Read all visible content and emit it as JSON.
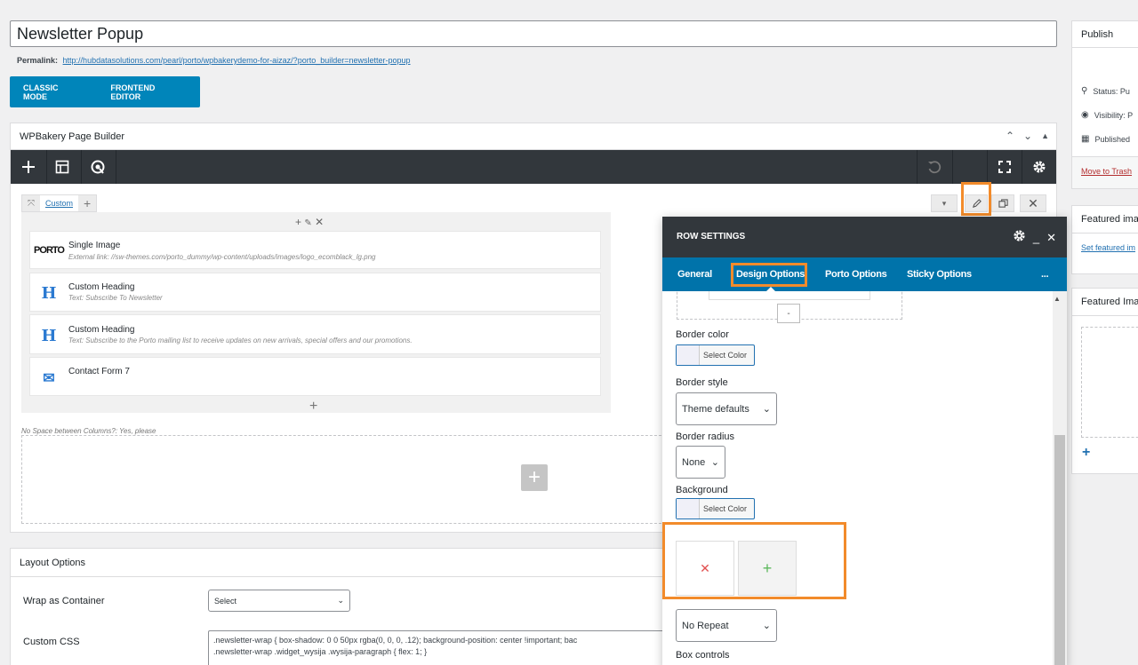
{
  "post": {
    "title": "Newsletter Popup",
    "permalink_label": "Permalink:",
    "permalink_url": "http://hubdatasolutions.com/pearl/porto/wpbakerydemo-for-aizaz/?porto_builder=newsletter-popup"
  },
  "modes": {
    "classic": "CLASSIC MODE",
    "frontend": "FRONTEND EDITOR"
  },
  "builder": {
    "title": "WPBakery Page Builder",
    "row_tab": "Custom",
    "elements": [
      {
        "name": "Single Image",
        "desc": "External link: //sw-themes.com/porto_dummy/wp-content/uploads/images/logo_ecomblack_lg.png",
        "icon": "porto-logo-icon",
        "icon_text": "PORTO"
      },
      {
        "name": "Custom Heading",
        "desc": "Text: Subscribe To Newsletter",
        "icon": "heading-icon",
        "icon_text": "H"
      },
      {
        "name": "Custom Heading",
        "desc": "Text: Subscribe to the Porto mailing list to receive updates on new arrivals, special offers and our promotions.",
        "icon": "heading-icon",
        "icon_text": "H"
      },
      {
        "name": "Contact Form 7",
        "desc": "",
        "icon": "envelope-icon",
        "icon_text": "✉"
      }
    ],
    "no_space": "No Space between Columns?: Yes, please"
  },
  "layout_options": {
    "title": "Layout Options",
    "wrap_label": "Wrap as Container",
    "wrap_value": "Select",
    "css_label": "Custom CSS",
    "css_line1": ".newsletter-wrap { box-shadow: 0 0 50px rgba(0, 0, 0, .12); background-position: center !important; bac",
    "css_line2": ".newsletter-wrap .widget_wysija .wysija-paragraph { flex: 1; }"
  },
  "sidebar": {
    "publish": "Publish",
    "status": "Status: Pu",
    "visibility": "Visibility: P",
    "published": "Published",
    "trash": "Move to Trash",
    "featured1": "Featured ima",
    "featured1_link": "Set featured im",
    "featured2": "Featured Ima"
  },
  "modal": {
    "title": "ROW SETTINGS",
    "tabs": [
      "General",
      "Design Options",
      "Porto Options",
      "Sticky Options"
    ],
    "more": "...",
    "minus": "-",
    "border_color": "Border color",
    "select_color": "Select Color",
    "border_style": "Border style",
    "border_style_value": "Theme defaults",
    "border_radius": "Border radius",
    "border_radius_value": "None",
    "background": "Background",
    "bg_select_color": "Select Color",
    "repeat_value": "No Repeat",
    "box_controls": "Box controls"
  },
  "colors": {
    "accent": "#0073aa",
    "toolbar": "#32373c",
    "highlight": "#f28b2b"
  }
}
